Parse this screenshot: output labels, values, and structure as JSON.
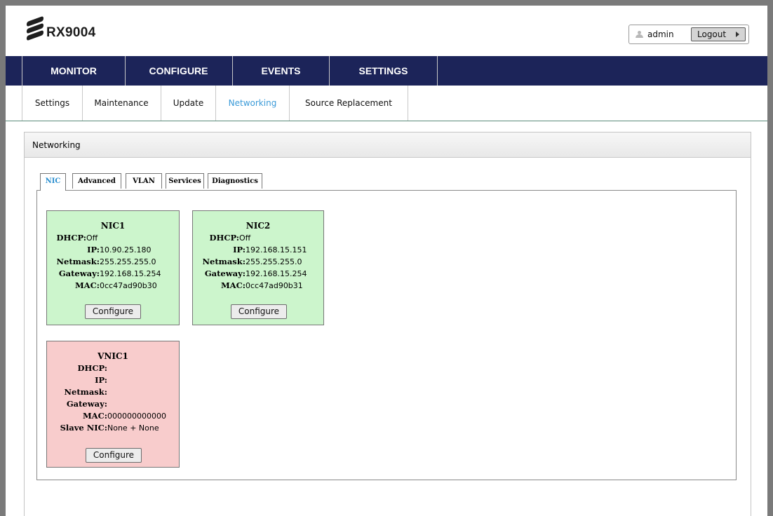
{
  "header": {
    "product": "RX9004",
    "user": "admin",
    "logout_label": "Logout"
  },
  "main_nav": [
    "MONITOR",
    "CONFIGURE",
    "EVENTS",
    "SETTINGS"
  ],
  "sub_nav": [
    "Settings",
    "Maintenance",
    "Update",
    "Networking",
    "Source Replacement"
  ],
  "sub_nav_active": "Networking",
  "panel": {
    "title": "Networking"
  },
  "tabs": [
    "NIC",
    "Advanced",
    "VLAN",
    "Services",
    "Diagnostics"
  ],
  "tabs_active": "NIC",
  "cards": {
    "nic1": {
      "title": "NIC1",
      "rows": [
        {
          "label": "DHCP:",
          "value": "Off"
        },
        {
          "label": "IP:",
          "value": "10.90.25.180"
        },
        {
          "label": "Netmask:",
          "value": "255.255.255.0"
        },
        {
          "label": "Gateway:",
          "value": "192.168.15.254"
        },
        {
          "label": "MAC:",
          "value": "0cc47ad90b30"
        }
      ],
      "button": "Configure",
      "color": "#ccf5cc"
    },
    "nic2": {
      "title": "NIC2",
      "rows": [
        {
          "label": "DHCP:",
          "value": "Off"
        },
        {
          "label": "IP:",
          "value": "192.168.15.151"
        },
        {
          "label": "Netmask:",
          "value": "255.255.255.0"
        },
        {
          "label": "Gateway:",
          "value": "192.168.15.254"
        },
        {
          "label": "MAC:",
          "value": "0cc47ad90b31"
        }
      ],
      "button": "Configure",
      "color": "#ccf5cc"
    },
    "vnic1": {
      "title": "VNIC1",
      "rows": [
        {
          "label": "DHCP:",
          "value": ""
        },
        {
          "label": "IP:",
          "value": ""
        },
        {
          "label": "Netmask:",
          "value": ""
        },
        {
          "label": "Gateway:",
          "value": ""
        },
        {
          "label": "MAC:",
          "value": "000000000000"
        },
        {
          "label": "Slave NIC:",
          "value": "None + None"
        }
      ],
      "button": "Configure",
      "color": "#f8cccc"
    }
  },
  "colors": {
    "nav_bg": "#1c2459",
    "active_link": "#3a9ad8",
    "ok_card": "#ccf5cc",
    "virtual_card": "#f8cccc"
  }
}
